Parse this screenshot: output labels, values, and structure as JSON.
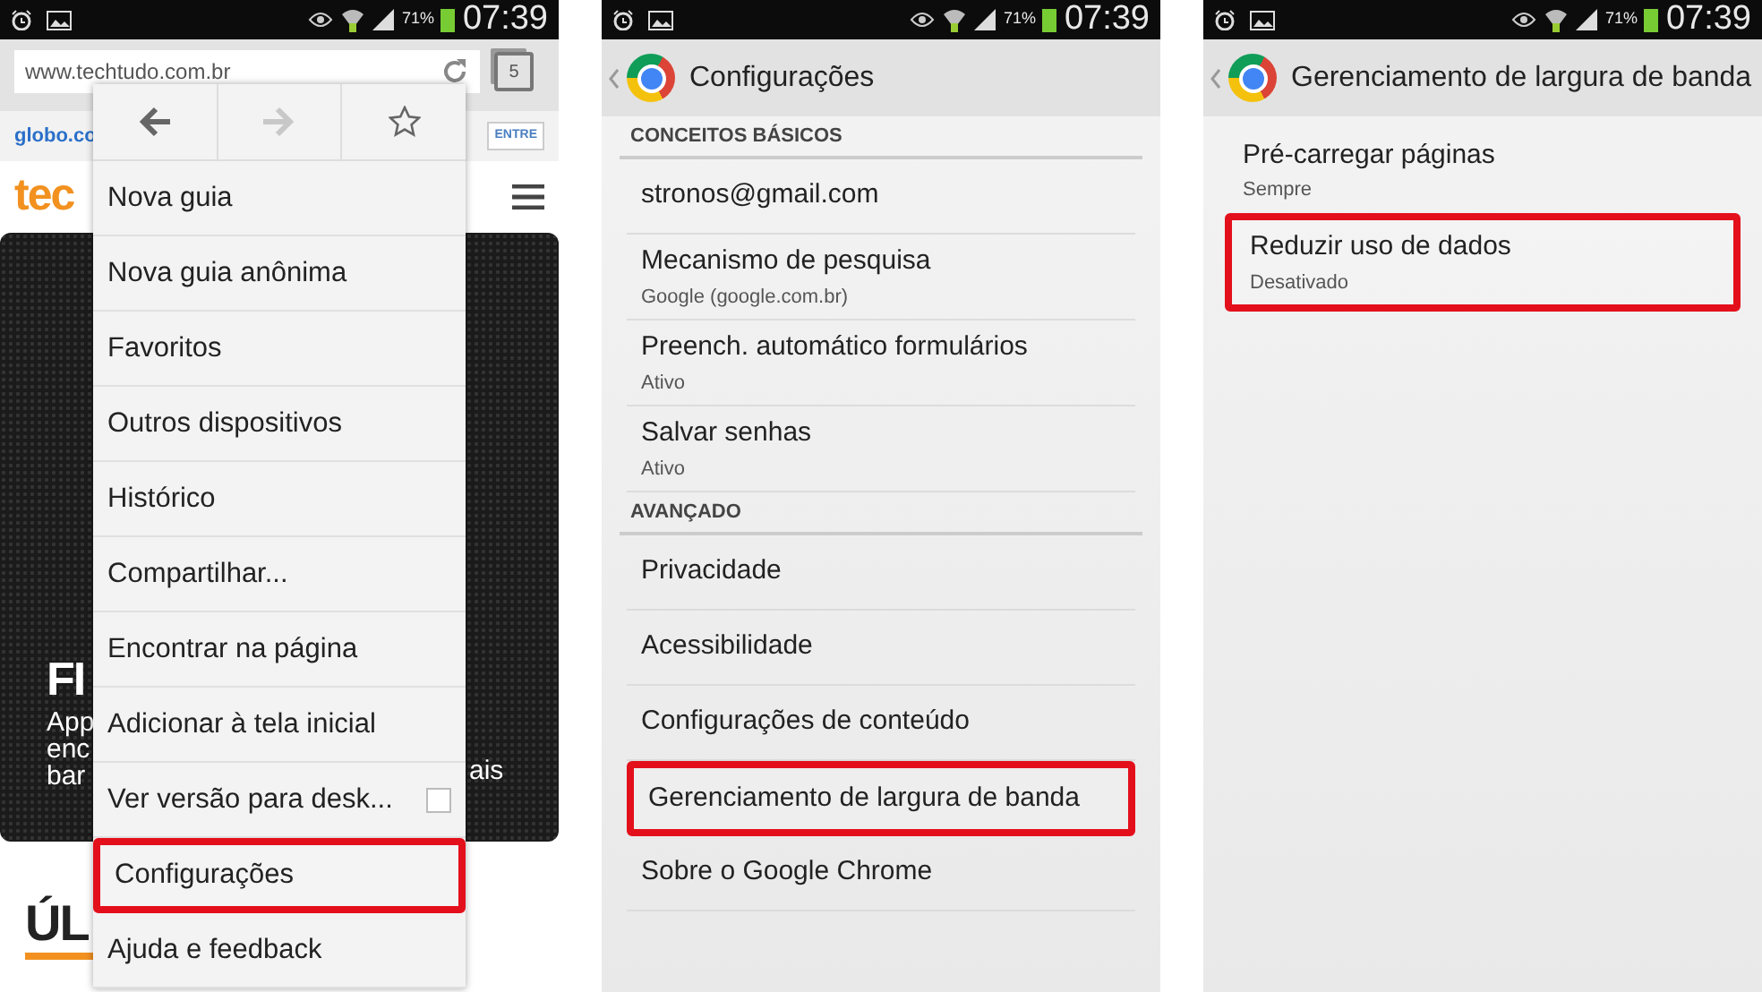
{
  "panels": [
    {
      "kind": "browser",
      "status_bar": {
        "battery": "71%",
        "time": "07:39"
      },
      "url": "www.techtudo.com.br",
      "tab_count": "5",
      "page": {
        "site_link": "globo.co",
        "login_button": "ENTRE",
        "logo": "tec",
        "hero_title": "FI",
        "hero_lines": [
          "App",
          "enc",
          "bar"
        ],
        "hero_right": "ais",
        "section_heading": "ÚL"
      },
      "menu": {
        "nav_buttons": [
          {
            "kind": "back",
            "disabled": false
          },
          {
            "kind": "forward",
            "disabled": true
          },
          {
            "kind": "bookmark",
            "disabled": false
          }
        ],
        "items": [
          {
            "kind": "entry",
            "label": "Nova guia",
            "highlighted": false
          },
          {
            "kind": "entry",
            "label": "Nova guia anônima",
            "highlighted": false
          },
          {
            "kind": "entry",
            "label": "Favoritos",
            "highlighted": false
          },
          {
            "kind": "entry",
            "label": "Outros dispositivos",
            "highlighted": false
          },
          {
            "kind": "entry",
            "label": "Histórico",
            "highlighted": false
          },
          {
            "kind": "entry",
            "label": "Compartilhar...",
            "highlighted": false
          },
          {
            "kind": "entry",
            "label": "Encontrar na página",
            "highlighted": false
          },
          {
            "kind": "entry",
            "label": "Adicionar à tela inicial",
            "highlighted": false
          },
          {
            "kind": "checkbox",
            "label": "Ver versão para desk...",
            "checked": false,
            "highlighted": false
          },
          {
            "kind": "entry",
            "label": "Configurações",
            "highlighted": true
          },
          {
            "kind": "entry",
            "label": "Ajuda e feedback",
            "highlighted": false
          }
        ]
      }
    },
    {
      "kind": "settings",
      "status_bar": {
        "battery": "71%",
        "time": "07:39"
      },
      "title": "Configurações",
      "items": [
        {
          "kind": "section",
          "label": "CONCEITOS BÁSICOS"
        },
        {
          "kind": "entry",
          "label": "stronos@gmail.com",
          "highlighted": false
        },
        {
          "kind": "entry",
          "label": "Mecanismo de pesquisa",
          "subtitle": "Google (google.com.br)",
          "highlighted": false
        },
        {
          "kind": "entry",
          "label": "Preench. automático formulários",
          "subtitle": "Ativo",
          "highlighted": false
        },
        {
          "kind": "entry",
          "label": "Salvar senhas",
          "subtitle": "Ativo",
          "highlighted": false
        },
        {
          "kind": "section",
          "label": "AVANÇADO"
        },
        {
          "kind": "entry",
          "label": "Privacidade",
          "highlighted": false
        },
        {
          "kind": "entry",
          "label": "Acessibilidade",
          "highlighted": false
        },
        {
          "kind": "entry",
          "label": "Configurações de conteúdo",
          "highlighted": false
        },
        {
          "kind": "entry",
          "label": "Gerenciamento de largura de banda",
          "highlighted": true
        },
        {
          "kind": "entry",
          "label": "Sobre o Google Chrome",
          "highlighted": false
        }
      ]
    },
    {
      "kind": "settings",
      "status_bar": {
        "battery": "71%",
        "time": "07:39"
      },
      "title": "Gerenciamento de largura de banda",
      "items": [
        {
          "kind": "entry",
          "label": "Pré-carregar páginas",
          "subtitle": "Sempre",
          "highlighted": false
        },
        {
          "kind": "entry",
          "label": "Reduzir uso de dados",
          "subtitle": "Desativado",
          "highlighted": true
        }
      ]
    }
  ]
}
